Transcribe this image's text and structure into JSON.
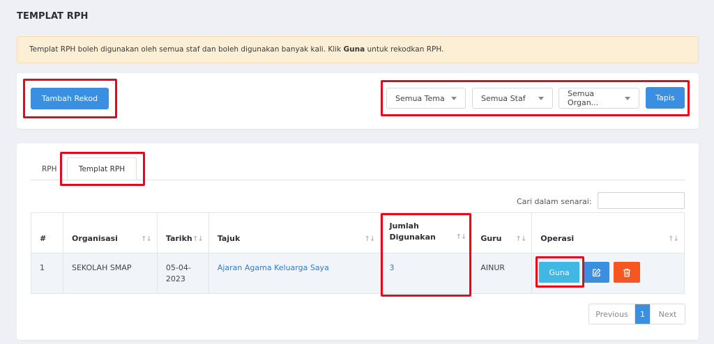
{
  "page": {
    "title": "TEMPLAT RPH"
  },
  "alert": {
    "text_before": "Templat RPH boleh digunakan oleh semua staf dan boleh digunakan banyak kali. Klik ",
    "text_bold": "Guna",
    "text_after": " untuk rekodkan RPH."
  },
  "toolbar": {
    "add_label": "Tambah Rekod",
    "filters": [
      {
        "label": "Semua Tema"
      },
      {
        "label": "Semua Staf"
      },
      {
        "label": "Semua Organ..."
      }
    ],
    "filter_button": "Tapis"
  },
  "tabs": [
    {
      "label": "RPH",
      "active": false
    },
    {
      "label": "Templat RPH",
      "active": true
    }
  ],
  "search": {
    "label": "Cari dalam senarai:"
  },
  "table": {
    "headers": {
      "num": "#",
      "org": "Organisasi",
      "date": "Tarikh",
      "title": "Tajuk",
      "used_line1": "Jumlah",
      "used_line2": "Digunakan",
      "teacher": "Guru",
      "ops": "Operasi"
    },
    "rows": [
      {
        "num": "1",
        "org": "SEKOLAH SMAP",
        "date_line1": "05-04-",
        "date_line2": "2023",
        "title": "Ajaran Agama Keluarga Saya",
        "used": "3",
        "teacher": "AINUR",
        "use_label": "Guna"
      }
    ]
  },
  "pagination": {
    "previous": "Previous",
    "current": "1",
    "next": "Next"
  },
  "colors": {
    "primary": "#3a8fe0",
    "info": "#40b8e3",
    "danger": "#f6561f",
    "highlight": "#e5091b",
    "link": "#2b7bd1"
  },
  "icons": {
    "edit": "edit-icon",
    "delete": "trash-icon",
    "sort": "sort-icon"
  }
}
